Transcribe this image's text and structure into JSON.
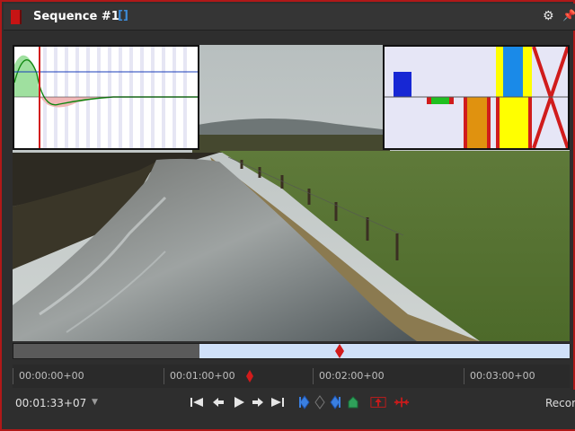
{
  "window": {
    "title": "Sequence #1",
    "title_bracket": "[]",
    "accent_color": "#c71414",
    "gear_icon": "gears-icon",
    "pin_icon": "pin-icon"
  },
  "scrubber": {
    "position_fraction": 0.59,
    "loaded_fraction": 0.667
  },
  "ruler": {
    "ticks": [
      "00:00:00+00",
      "00:01:00+00",
      "00:02:00+00",
      "00:03:00+00"
    ]
  },
  "transport": {
    "timecode": "00:01:33+07",
    "dropdown_glyph": "▼",
    "record_label": "Recor",
    "buttons": [
      "go-to-start",
      "step-back",
      "play",
      "step-forward",
      "go-to-end",
      "set-mark",
      "clear-mark",
      "next-mark",
      "drop-marker",
      "cut-in",
      "cut-out"
    ]
  }
}
